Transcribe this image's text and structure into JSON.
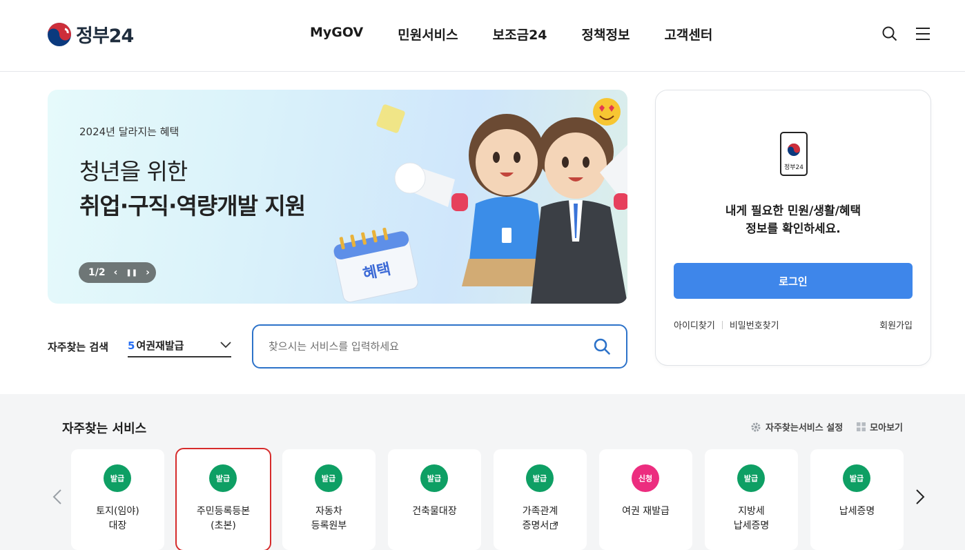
{
  "header": {
    "logo_text": "정부24",
    "nav": [
      "MyGOV",
      "민원서비스",
      "보조금24",
      "정책정보",
      "고객센터"
    ]
  },
  "banner": {
    "subtitle": "2024년 달라지는 혜택",
    "title_line1": "청년을 위한",
    "title_line2": "취업·구직·역량개발 지원",
    "pager": "1/2",
    "calendar_tag": "혜택"
  },
  "search": {
    "freq_label": "자주찾는 검색",
    "freq_rank": "5",
    "freq_item": "여권재발급",
    "placeholder": "찾으시는 서비스를 입력하세요"
  },
  "login": {
    "device_label": "정부24",
    "message_line1": "내게 필요한 민원/생활/혜택",
    "message_line2": "정보를 확인하세요.",
    "login_button": "로그인",
    "find_id": "아이디찾기",
    "find_pw": "비밀번호찾기",
    "join": "회원가입"
  },
  "services": {
    "title": "자주찾는 서비스",
    "settings_label": "자주찾는서비스 설정",
    "view_all_label": "모아보기",
    "items": [
      {
        "badge": "발급",
        "name": "토지(임야)\n대장",
        "color": "#0e9f64"
      },
      {
        "badge": "발급",
        "name": "주민등록등본\n(초본)",
        "color": "#0e9f64"
      },
      {
        "badge": "발급",
        "name": "자동차\n등록원부",
        "color": "#0e9f64"
      },
      {
        "badge": "발급",
        "name": "건축물대장",
        "color": "#0e9f64"
      },
      {
        "badge": "발급",
        "name": "가족관계\n증명서",
        "color": "#0e9f64"
      },
      {
        "badge": "신청",
        "name": "여권 재발급",
        "color": "#ec2d7f"
      },
      {
        "badge": "발급",
        "name": "지방세\n납세증명",
        "color": "#0e9f64"
      },
      {
        "badge": "발급",
        "name": "납세증명",
        "color": "#0e9f64"
      }
    ]
  },
  "colors": {
    "primary_blue": "#3e86ea",
    "issue_green": "#0e9f64",
    "apply_pink": "#ec2d7f",
    "selection_red": "#d62b2b"
  }
}
